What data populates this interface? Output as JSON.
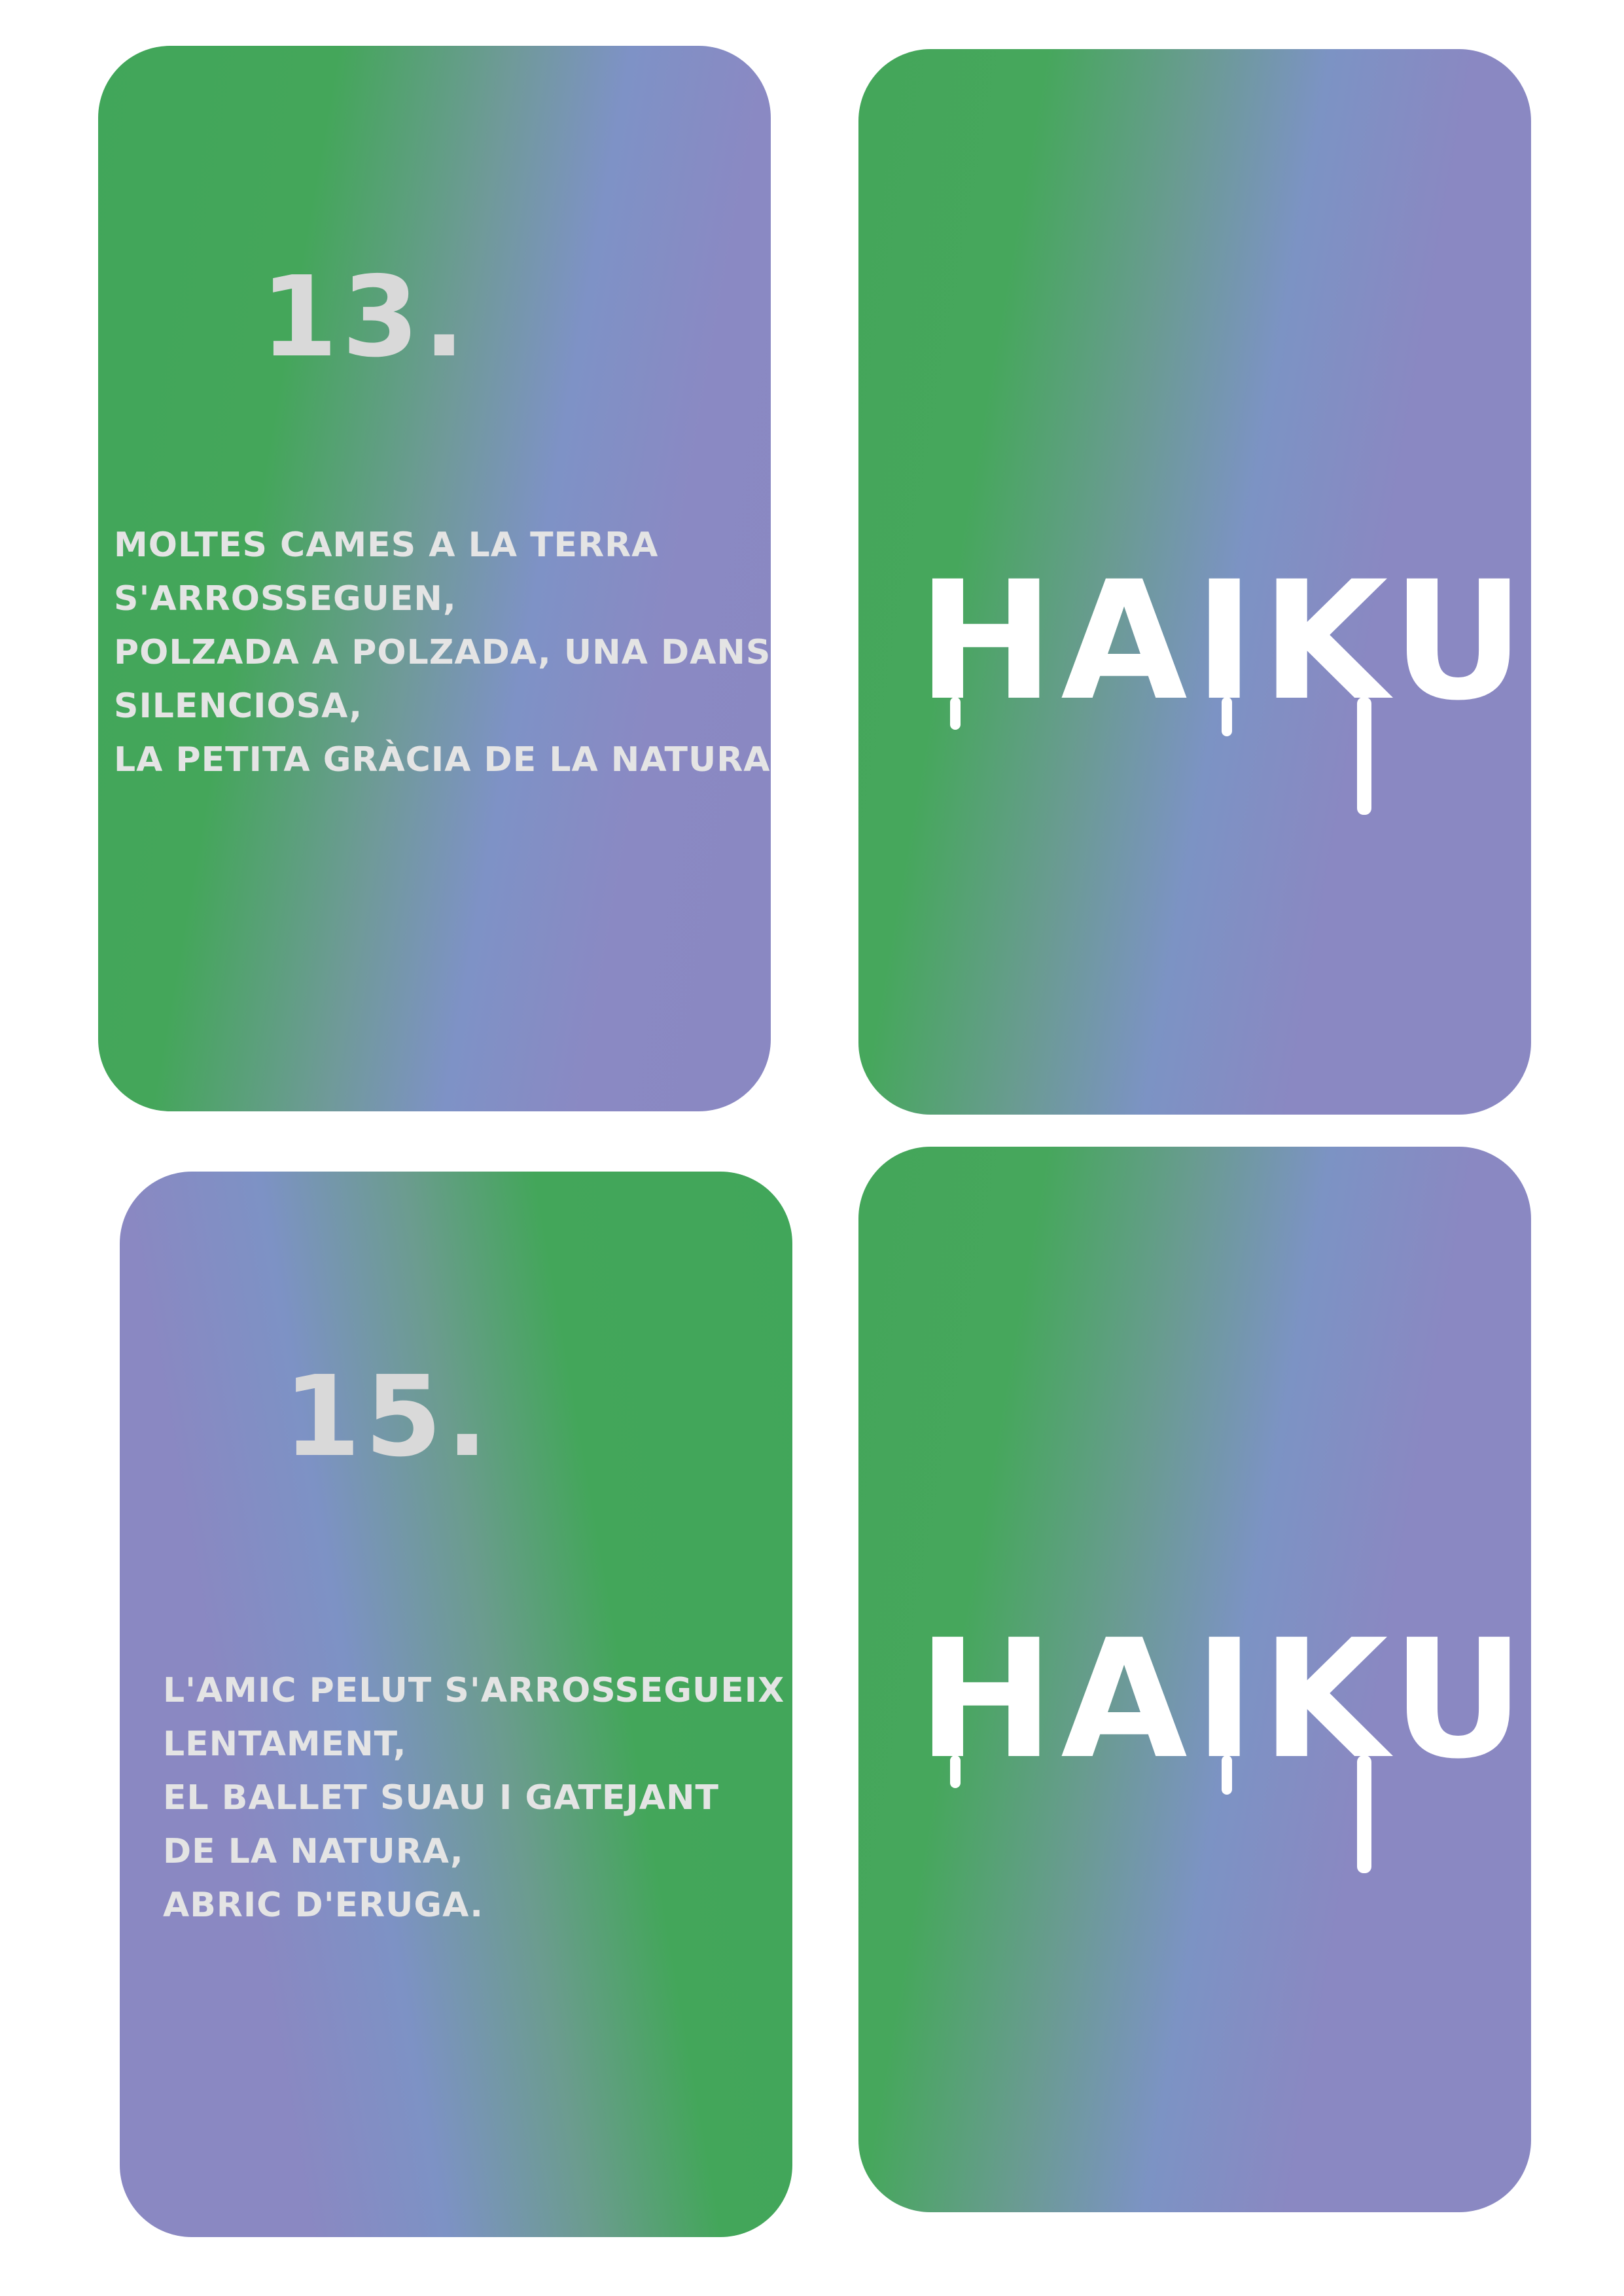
{
  "cards": {
    "card13": {
      "number": "13.",
      "lines": [
        "MOLTES CAMES A LA TERRA",
        "S'ARROSSEGUEN,",
        "POLZADA A POLZADA, UNA DANSA",
        "SILENCIOSA,",
        "LA PETITA GRÀCIA DE LA NATURA."
      ]
    },
    "back_top": {
      "title": "HAIKU!"
    },
    "card15": {
      "number": "15.",
      "lines": [
        "L'AMIC PELUT S'ARROSSEGUEIX",
        "LENTAMENT,",
        "EL BALLET SUAU I GATEJANT",
        "DE LA NATURA,",
        "ABRIC D'ERUGA."
      ]
    },
    "back_bottom": {
      "title": "HAIKU!"
    }
  },
  "colors": {
    "green": "#41a65a",
    "blue": "#7e92c6",
    "purple": "#8a88c2",
    "text_light": "#e4e4e4"
  }
}
